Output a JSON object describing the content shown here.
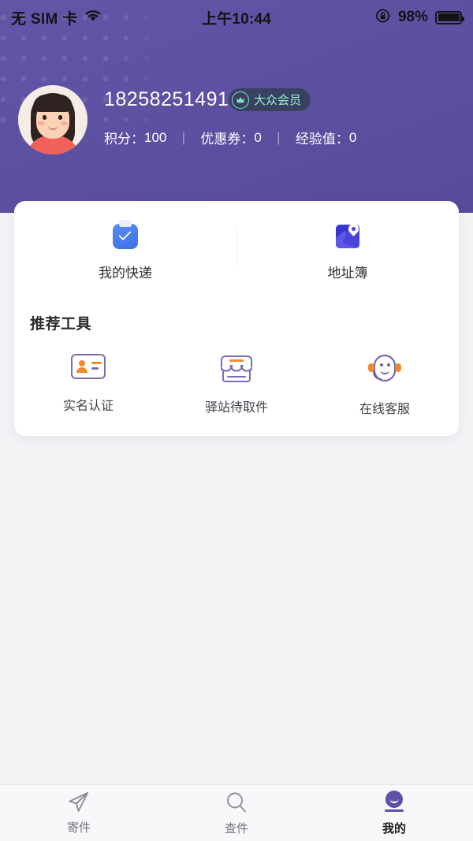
{
  "status_bar": {
    "carrier": "无 SIM 卡",
    "wifi_icon": "wifi-icon",
    "time": "上午10:44",
    "rotation_lock_icon": "rotation-lock-icon",
    "battery_percent": "98%",
    "battery_icon": "battery-full-icon"
  },
  "header": {
    "background_color": "#5b4fa3",
    "avatar_name": "user-avatar",
    "username": "18258251491",
    "vip_badge": {
      "icon": "crown-icon",
      "label": "大众会员",
      "text_color": "#9beed0",
      "pill_color": "#1e3430"
    },
    "stats": [
      {
        "label": "积分：",
        "value": "100"
      },
      {
        "label": "优惠券：",
        "value": "0"
      },
      {
        "label": "经验值：",
        "value": "0"
      }
    ],
    "separator": "丨"
  },
  "card": {
    "quick_actions": [
      {
        "icon": "clipboard-check-icon",
        "label": "我的快递",
        "color": "#3b6fe8"
      },
      {
        "icon": "map-pin-icon",
        "label": "地址簿",
        "color": "#3b34cf"
      }
    ],
    "tools_title": "推荐工具",
    "tools": [
      {
        "icon": "id-card-icon",
        "label": "实名认证"
      },
      {
        "icon": "storefront-icon",
        "label": "驿站待取件"
      },
      {
        "icon": "customer-service-icon",
        "label": "在线客服"
      }
    ]
  },
  "tabbar": {
    "active_color": "#5e4fa8",
    "items": [
      {
        "icon": "paper-plane-icon",
        "label": "寄件",
        "active": false
      },
      {
        "icon": "search-icon",
        "label": "查件",
        "active": false
      },
      {
        "icon": "person-icon",
        "label": "我的",
        "active": true
      }
    ]
  }
}
